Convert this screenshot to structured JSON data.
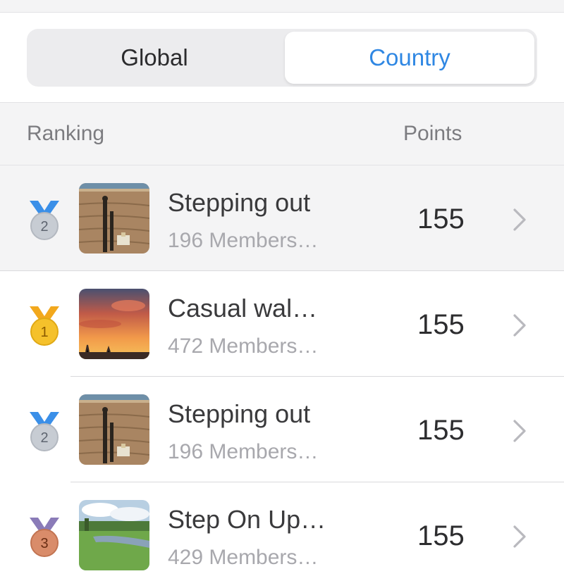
{
  "tabs": {
    "global": "Global",
    "country": "Country",
    "selected": "Country"
  },
  "header": {
    "ranking": "Ranking",
    "points": "Points"
  },
  "rows": [
    {
      "rank": "2",
      "medal": "silver",
      "name": "Stepping out",
      "members": "196 Members…",
      "points": "155",
      "thumb": "beach-shadow-photo"
    },
    {
      "rank": "1",
      "medal": "gold",
      "name": "Casual wal…",
      "members": "472 Members…",
      "points": "155",
      "thumb": "sunset-photo"
    },
    {
      "rank": "2",
      "medal": "silver",
      "name": "Stepping out",
      "members": "196 Members…",
      "points": "155",
      "thumb": "beach-shadow-photo"
    },
    {
      "rank": "3",
      "medal": "bronze",
      "name": "Step On Up…",
      "members": "429 Members…",
      "points": "155",
      "thumb": "countryside-river-photo"
    }
  ],
  "colors": {
    "accent": "#2f87e3",
    "gold": "#f5c12b",
    "silver": "#c7ccd3",
    "bronze": "#d98c6a",
    "ribbon_blue": "#3a8fe8",
    "ribbon_gold": "#f2a81d",
    "ribbon_purple": "#8a7bb8"
  }
}
